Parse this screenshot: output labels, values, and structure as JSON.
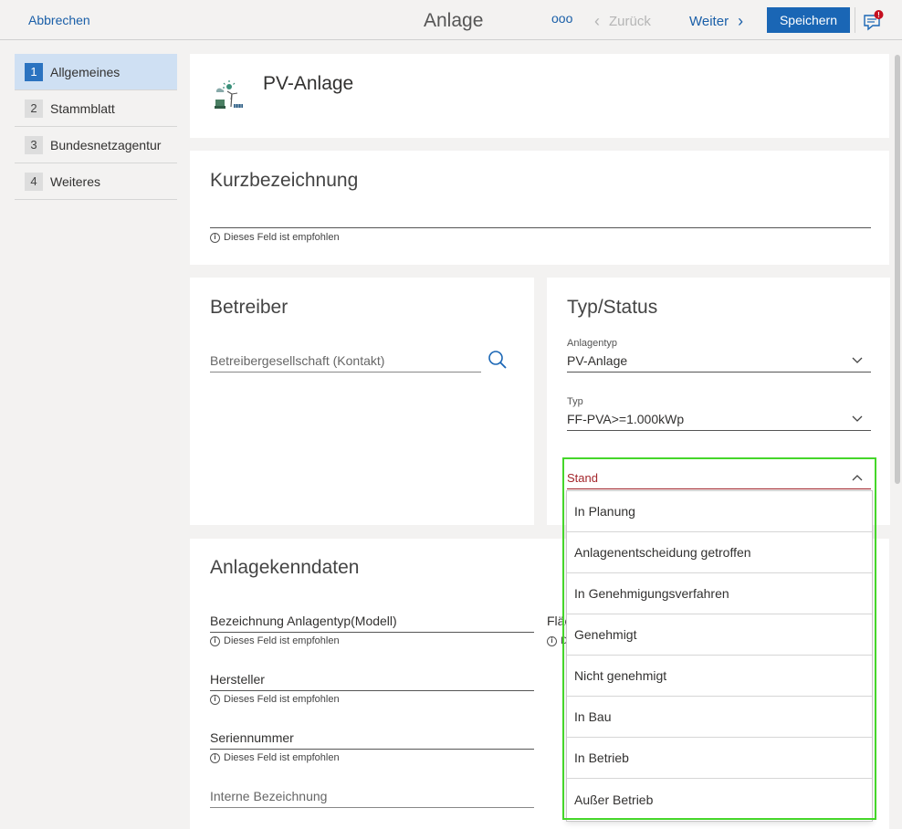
{
  "topbar": {
    "cancel_label": "Abbrechen",
    "title": "Anlage",
    "more_label": "ooo",
    "back_label": "Zurück",
    "next_label": "Weiter",
    "save_label": "Speichern",
    "notification_badge": "!"
  },
  "nav": {
    "items": [
      {
        "num": "1",
        "label": "Allgemeines",
        "active": true
      },
      {
        "num": "2",
        "label": "Stammblatt",
        "active": false
      },
      {
        "num": "3",
        "label": "Bundesnetzagentur",
        "active": false
      },
      {
        "num": "4",
        "label": "Weiteres",
        "active": false
      }
    ]
  },
  "header": {
    "title": "PV-Anlage",
    "icon": "pv-plant-icon"
  },
  "kurz": {
    "title": "Kurzbezeichnung",
    "hint": "Dieses Feld ist empfohlen"
  },
  "betreiber": {
    "title": "Betreiber",
    "placeholder": "Betreibergesellschaft (Kontakt)"
  },
  "typstatus": {
    "title": "Typ/Status",
    "anlagentyp_label": "Anlagentyp",
    "anlagentyp_value": "PV-Anlage",
    "typ_label": "Typ",
    "typ_value": "FF-PVA>=1.000kWp",
    "stand_label": "Stand"
  },
  "kenndaten": {
    "title": "Anlagekenndaten",
    "bezeichnung_label": "Bezeichnung Anlagentyp(Modell)",
    "bezeichnung_hint": "Dieses Feld ist empfohlen",
    "flaeche_label": "Fläc",
    "flaeche_hint": "D",
    "hersteller_label": "Hersteller",
    "hersteller_hint": "Dieses Feld ist empfohlen",
    "seriennummer_label": "Seriennummer",
    "seriennummer_hint": "Dieses Feld ist empfohlen",
    "interne_label": "Interne Bezeichnung"
  },
  "stand_dropdown": {
    "options": [
      "In Planung",
      "Anlagenentscheidung getroffen",
      "In Genehmigungsverfahren",
      "Genehmigt",
      "Nicht genehmigt",
      "In Bau",
      "In Betrieb",
      "Außer Betrieb"
    ]
  },
  "colors": {
    "accent": "#1a66b5",
    "link": "#1a5fa8",
    "error": "#a4262c",
    "highlight": "#45d62a",
    "nav_active": "#cfe0f3"
  }
}
